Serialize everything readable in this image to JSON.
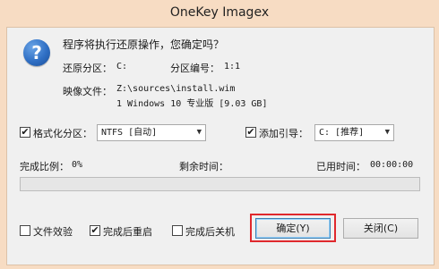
{
  "window": {
    "title": "OneKey Imagex"
  },
  "prompt": {
    "question": "程序将执行还原操作，您确定吗？"
  },
  "info": {
    "restore_partition_label": "还原分区：",
    "restore_partition_value": "C:",
    "partition_number_label": "分区编号：",
    "partition_number_value": "1:1",
    "image_file_label": "映像文件：",
    "image_file_path": "Z:\\sources\\install.wim",
    "image_file_desc": "1 Windows 10 专业版 [9.03 GB]"
  },
  "options": {
    "format": {
      "label": "格式化分区：",
      "checked": true,
      "select_value": "NTFS [自动]"
    },
    "boot": {
      "label": "添加引导：",
      "checked": true,
      "select_value": "C: [推荐]"
    }
  },
  "progress": {
    "ratio_label": "完成比例：",
    "ratio_value": "0%",
    "remaining_label": "剩余时间：",
    "remaining_value": "",
    "elapsed_label": "已用时间：",
    "elapsed_value": "00:00:00",
    "fraction": 0
  },
  "bottom": {
    "verify_label": "文件效验",
    "verify_checked": false,
    "restart_label": "完成后重启",
    "restart_checked": true,
    "shutdown_label": "完成后关机",
    "shutdown_checked": false,
    "ok_label": "确定(Y)",
    "close_label": "关闭(C)"
  },
  "colors": {
    "highlight": "#e0282d",
    "progress_fill": "#06b025",
    "frame": "#f7dcc3"
  },
  "icons": {
    "question": "question-icon",
    "dropdown": "chevron-down-icon",
    "check": "checkmark-icon"
  }
}
